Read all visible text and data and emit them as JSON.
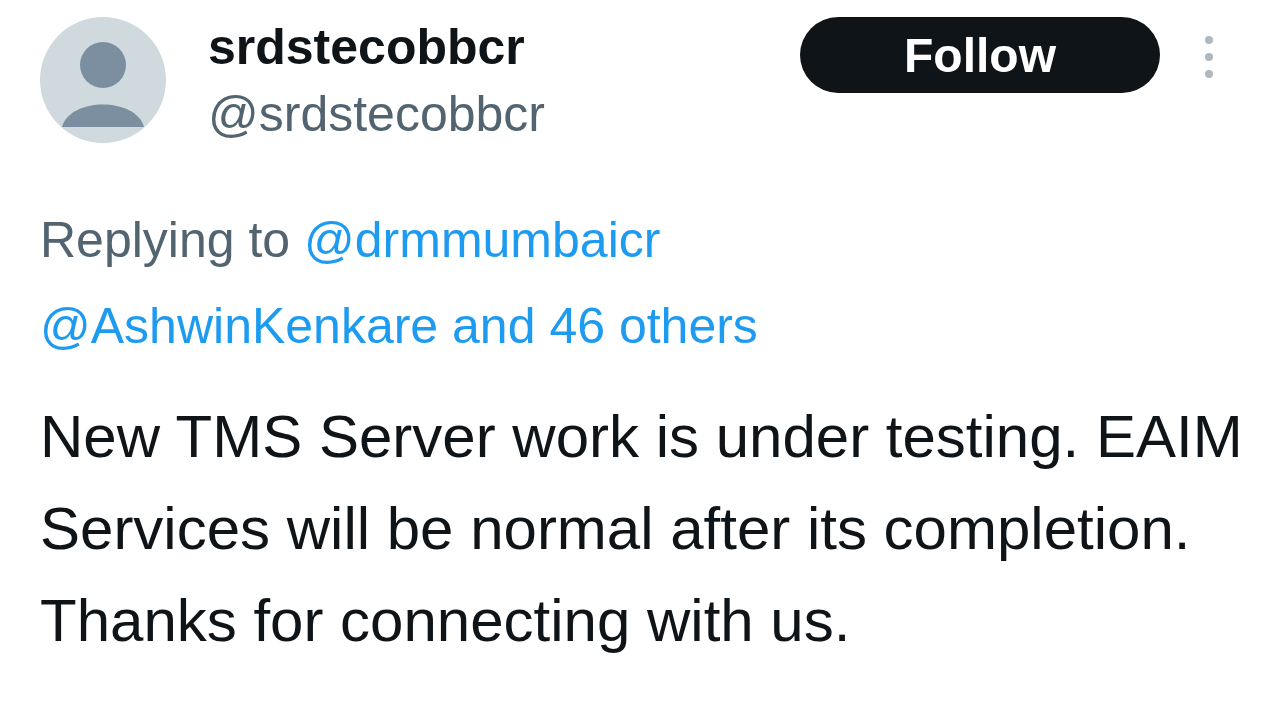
{
  "author": {
    "name": "srdstecobbcr",
    "handle": "@srdstecobbcr"
  },
  "follow_button": {
    "label": "Follow"
  },
  "reply_context": {
    "prefix": "Replying to",
    "mentions": [
      "@drmmumbaicr",
      "@AshwinKenkare and 46 others"
    ]
  },
  "text": "New TMS Server work is under testing. EAIM Services will be normal after its completion. Thanks for connecting with us."
}
